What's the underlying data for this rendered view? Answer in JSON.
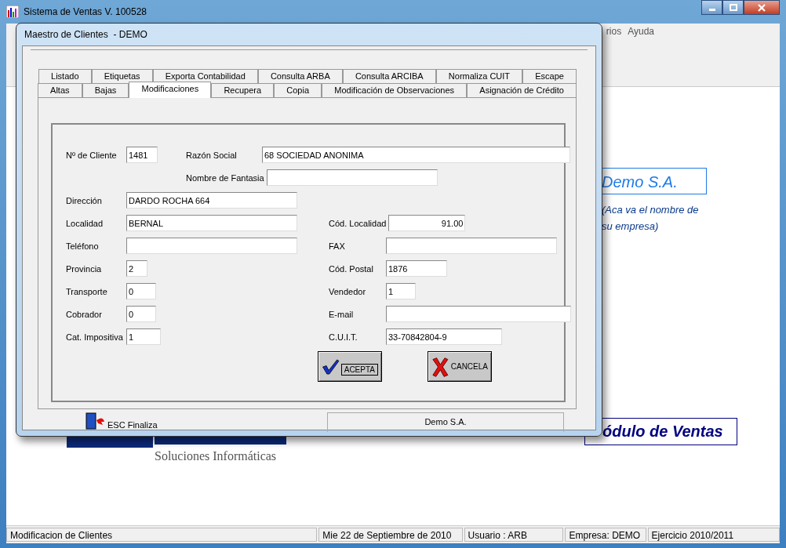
{
  "window": {
    "title": "Sistema de Ventas V. 100528"
  },
  "menu": [
    "rios",
    "Ayuda"
  ],
  "background": {
    "company": "Demo S.A.",
    "company_hint": "(Aca va el nombre de su empresa)",
    "module": "ódulo de Ventas",
    "logo_tagline": "Soluciones Informáticas"
  },
  "dialog": {
    "title": "Maestro de Clientes  - DEMO",
    "tab_rows": [
      [
        {
          "label": "Listado",
          "selected": false
        },
        {
          "label": "Etiquetas",
          "selected": false
        },
        {
          "label": "Exporta Contabilidad",
          "selected": false
        },
        {
          "label": "Consulta ARBA",
          "selected": false
        },
        {
          "label": "Consulta ARCIBA",
          "selected": false
        },
        {
          "label": "Normaliza CUIT",
          "selected": false
        },
        {
          "label": "Escape",
          "selected": false
        }
      ],
      [
        {
          "label": "Altas",
          "selected": false
        },
        {
          "label": "Bajas",
          "selected": false
        },
        {
          "label": "Modificaciones",
          "selected": true
        },
        {
          "label": "Recupera",
          "selected": false
        },
        {
          "label": "Copia",
          "selected": false
        },
        {
          "label": "Modificación de Observaciones",
          "selected": false
        },
        {
          "label": "Asignación de Crédito",
          "selected": false
        }
      ]
    ],
    "rows": [
      {
        "kind": "wide",
        "cells": [
          {
            "label": "Nº de Cliente",
            "value": "1481"
          },
          {
            "label": "Razón Social",
            "value": "68 SOCIEDAD ANONIMA"
          }
        ]
      },
      {
        "kind": "indent",
        "cells": [
          {
            "label": "Nombre de Fantasia"
          }
        ]
      },
      {
        "kind": "split",
        "cells": [
          {
            "label": "Dirección",
            "value": "DARDO ROCHA 664"
          }
        ]
      },
      {
        "kind": "split",
        "cells": [
          {
            "label": "Localidad",
            "value": "BERNAL"
          },
          {
            "label": "Cód. Localidad",
            "value": "91.00",
            "numeric": true
          }
        ]
      },
      {
        "kind": "split",
        "cells": [
          {
            "label": "Teléfono"
          },
          {
            "label": "FAX"
          }
        ]
      },
      {
        "kind": "split",
        "cells": [
          {
            "label": "Provincia",
            "value": "2"
          },
          {
            "label": "Cód. Postal",
            "value": "1876"
          }
        ]
      },
      {
        "kind": "split",
        "cells": [
          {
            "label": "Transporte",
            "value": "0"
          },
          {
            "label": "Vendedor",
            "value": "1"
          }
        ]
      },
      {
        "kind": "split",
        "cells": [
          {
            "label": "Cobrador",
            "value": "0"
          },
          {
            "label": "E-mail"
          }
        ]
      },
      {
        "kind": "split",
        "cells": [
          {
            "label": "Cat. Impositiva",
            "value": "1"
          },
          {
            "label": "C.U.I.T.",
            "value": "33-70842804-9"
          }
        ]
      }
    ],
    "buttons": [
      {
        "label": "ACEPTA",
        "kind": "accept"
      },
      {
        "label": "CANCELA",
        "kind": "cancel"
      }
    ],
    "footer": {
      "esc": "ESC Finaliza",
      "company": "Demo S.A."
    }
  },
  "status_bar": [
    "Modificacion de Clientes",
    "Mie 22 de Septiembre de 2010",
    "Usuario : ARB",
    "Empresa: DEMO",
    "Ejercicio 2010/2011"
  ]
}
